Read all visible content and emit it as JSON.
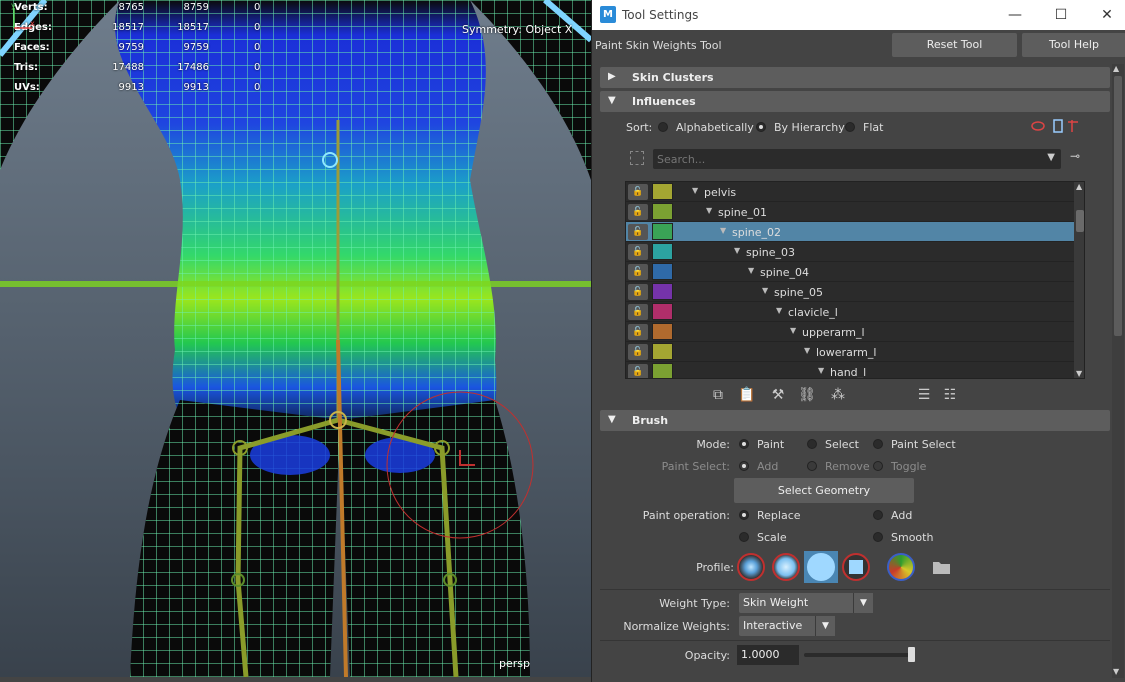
{
  "viewport": {
    "hud": [
      {
        "label": "Verts:",
        "v1": "8765",
        "v2": "8759",
        "v3": "0"
      },
      {
        "label": "Edges:",
        "v1": "18517",
        "v2": "18517",
        "v3": "0"
      },
      {
        "label": "Faces:",
        "v1": "9759",
        "v2": "9759",
        "v3": "0"
      },
      {
        "label": "Tris:",
        "v1": "17488",
        "v2": "17486",
        "v3": "0"
      },
      {
        "label": "UVs:",
        "v1": "9913",
        "v2": "9913",
        "v3": "0"
      }
    ],
    "symmetry": "Symmetry: Object X",
    "camera": "persp"
  },
  "window": {
    "app_icon": "M",
    "title": "Tool Settings",
    "minimize": "—",
    "maximize": "☐",
    "close": "✕"
  },
  "toolbar": {
    "tool_name": "Paint Skin Weights Tool",
    "reset_label": "Reset Tool",
    "help_label": "Tool Help"
  },
  "sections": {
    "skin_clusters": "Skin Clusters",
    "influences": "Influences",
    "brush": "Brush"
  },
  "influences": {
    "sort_label": "Sort:",
    "sort_options": [
      "Alphabetically",
      "By Hierarchy",
      "Flat"
    ],
    "sort_selected": "By Hierarchy",
    "search_placeholder": "Search...",
    "joints": [
      {
        "name": "pelvis",
        "depth": 0,
        "color": "#a4a632"
      },
      {
        "name": "spine_01",
        "depth": 1,
        "color": "#7ba132"
      },
      {
        "name": "spine_02",
        "depth": 2,
        "color": "#3aa356",
        "selected": true
      },
      {
        "name": "spine_03",
        "depth": 3,
        "color": "#2ca3a1"
      },
      {
        "name": "spine_04",
        "depth": 4,
        "color": "#2f6aa8"
      },
      {
        "name": "spine_05",
        "depth": 5,
        "color": "#7533aa"
      },
      {
        "name": "clavicle_l",
        "depth": 6,
        "color": "#b02e6a"
      },
      {
        "name": "upperarm_l",
        "depth": 7,
        "color": "#b06a2e"
      },
      {
        "name": "lowerarm_l",
        "depth": 8,
        "color": "#a4a632"
      },
      {
        "name": "hand_l",
        "depth": 9,
        "color": "#7ba132"
      }
    ]
  },
  "brush": {
    "mode_label": "Mode:",
    "mode_options": [
      "Paint",
      "Select",
      "Paint Select"
    ],
    "paint_select_label": "Paint Select:",
    "paint_select_options": [
      "Add",
      "Remove",
      "Toggle"
    ],
    "select_geometry": "Select Geometry",
    "paint_operation_label": "Paint operation:",
    "paint_operations": [
      "Replace",
      "Add",
      "Scale",
      "Smooth"
    ],
    "profile_label": "Profile:",
    "weight_type_label": "Weight Type:",
    "weight_type_value": "Skin Weight",
    "normalize_label": "Normalize Weights:",
    "normalize_value": "Interactive",
    "opacity_label": "Opacity:",
    "opacity_value": "1.0000"
  },
  "colors": {
    "selection": "#5285a6",
    "accent_red": "#c0302f",
    "wire": "#6cf0b0"
  }
}
